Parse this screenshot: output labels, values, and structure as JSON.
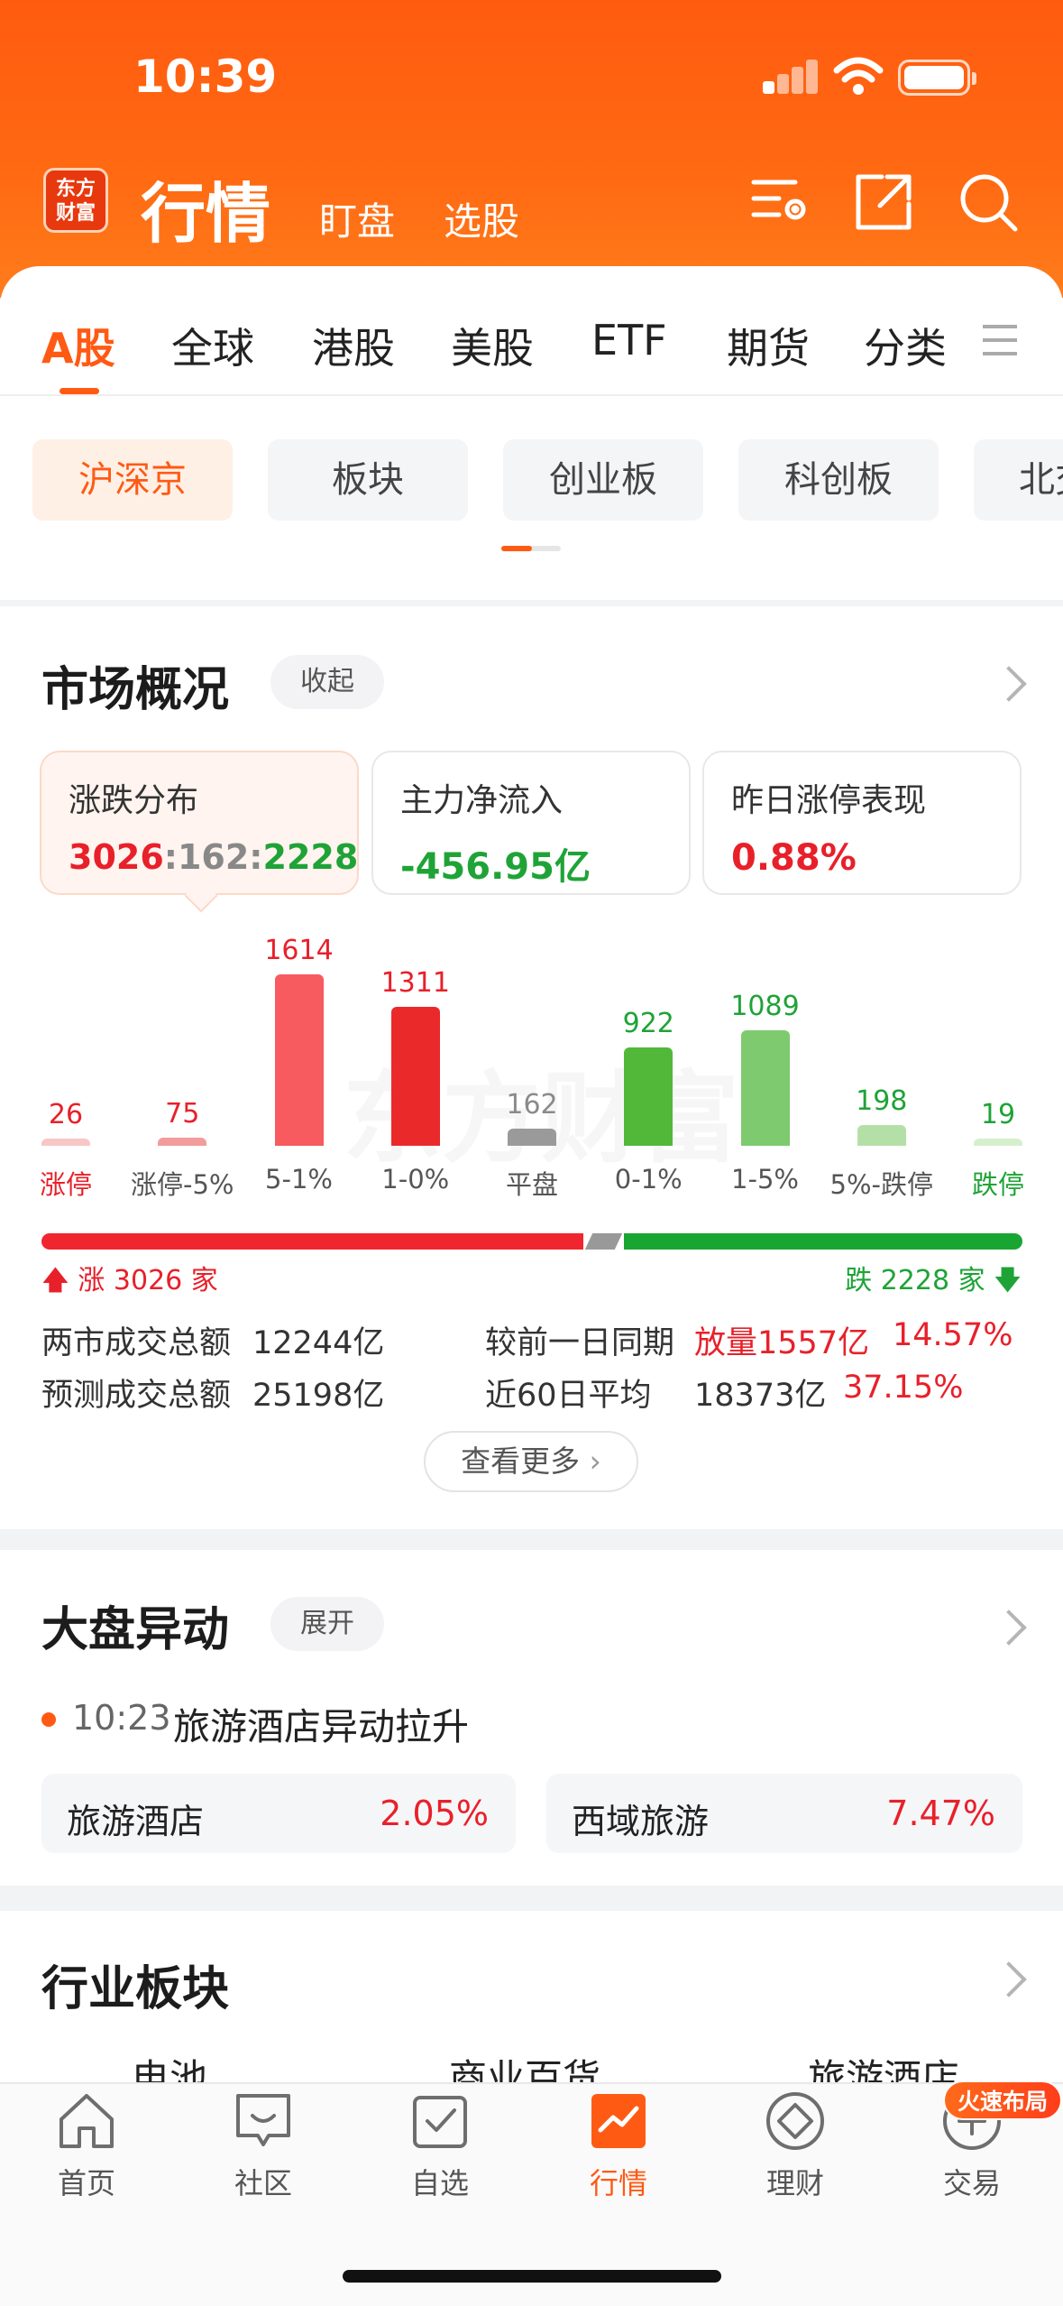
{
  "status_bar": {
    "time": "10:39"
  },
  "header": {
    "logo_text": "东方财富",
    "title": "行情",
    "sub_tabs": [
      "盯盘",
      "选股"
    ],
    "icons": [
      "filter-settings-icon",
      "share-icon",
      "search-icon"
    ]
  },
  "market_tabs": {
    "items": [
      "A股",
      "全球",
      "港股",
      "美股",
      "ETF",
      "期货",
      "分类"
    ],
    "active_index": 0,
    "accent": "#ff5a14"
  },
  "chips": {
    "items": [
      "沪深京",
      "板块",
      "创业板",
      "科创板",
      "北交所"
    ],
    "active_index": 0
  },
  "market_overview": {
    "title": "市场概况",
    "toggle_label": "收起",
    "cards": [
      {
        "label": "涨跌分布",
        "up": "3026",
        "flat": "162",
        "down": "2228"
      },
      {
        "label": "主力净流入",
        "value": "-456.95亿"
      },
      {
        "label": "昨日涨停表现",
        "value": "0.88%"
      }
    ],
    "summary": {
      "up_label": "涨 3026 家",
      "down_label": "跌 2228 家"
    },
    "rows": [
      {
        "label": "两市成交总额",
        "value": "12244亿",
        "cmp_label": "较前一日同期",
        "cmp_value": "放量1557亿",
        "cmp_pct": "14.57%"
      },
      {
        "label": "预测成交总额",
        "value": "25198亿",
        "cmp_label": "近60日平均",
        "cmp_value": "18373亿",
        "cmp_pct": "37.15%"
      }
    ],
    "more_label": "查看更多"
  },
  "chart_data": {
    "type": "bar",
    "categories": [
      "涨停",
      "涨停-5%",
      "5-1%",
      "1-0%",
      "平盘",
      "0-1%",
      "1-5%",
      "5%-跌停",
      "跌停"
    ],
    "values": [
      26,
      75,
      1614,
      1311,
      162,
      922,
      1089,
      198,
      19
    ],
    "bar_colors": [
      "#f9c6c6",
      "#f29c9c",
      "#f75a5f",
      "#ea2a2a",
      "#9a9a9a",
      "#52b83a",
      "#7dcb6e",
      "#b4e0a8",
      "#d5efcd"
    ],
    "value_colors": [
      "#e8202a",
      "#e8202a",
      "#e8202a",
      "#e8202a",
      "#8a8a8a",
      "#1fa337",
      "#1fa337",
      "#1fa337",
      "#1fa337"
    ],
    "label_colors": [
      "#e8202a",
      "#555555",
      "#555555",
      "#555555",
      "#555555",
      "#555555",
      "#555555",
      "#555555",
      "#1fa337"
    ],
    "ylim": [
      0,
      1614
    ]
  },
  "ratio_bar": {
    "up": 3026,
    "flat": 162,
    "down": 2228
  },
  "big_move": {
    "title": "大盘异动",
    "toggle_label": "展开",
    "event_time": "10:23",
    "event_text": "旅游酒店异动拉升",
    "items": [
      {
        "name": "旅游酒店",
        "pct": "2.05%"
      },
      {
        "name": "西域旅游",
        "pct": "7.47%"
      }
    ]
  },
  "industry": {
    "title": "行业板块",
    "items": [
      "电池",
      "商业百货",
      "旅游酒店"
    ]
  },
  "tab_bar": {
    "items": [
      "首页",
      "社区",
      "自选",
      "行情",
      "理财",
      "交易"
    ],
    "active_index": 3,
    "badge": "火速布局"
  }
}
